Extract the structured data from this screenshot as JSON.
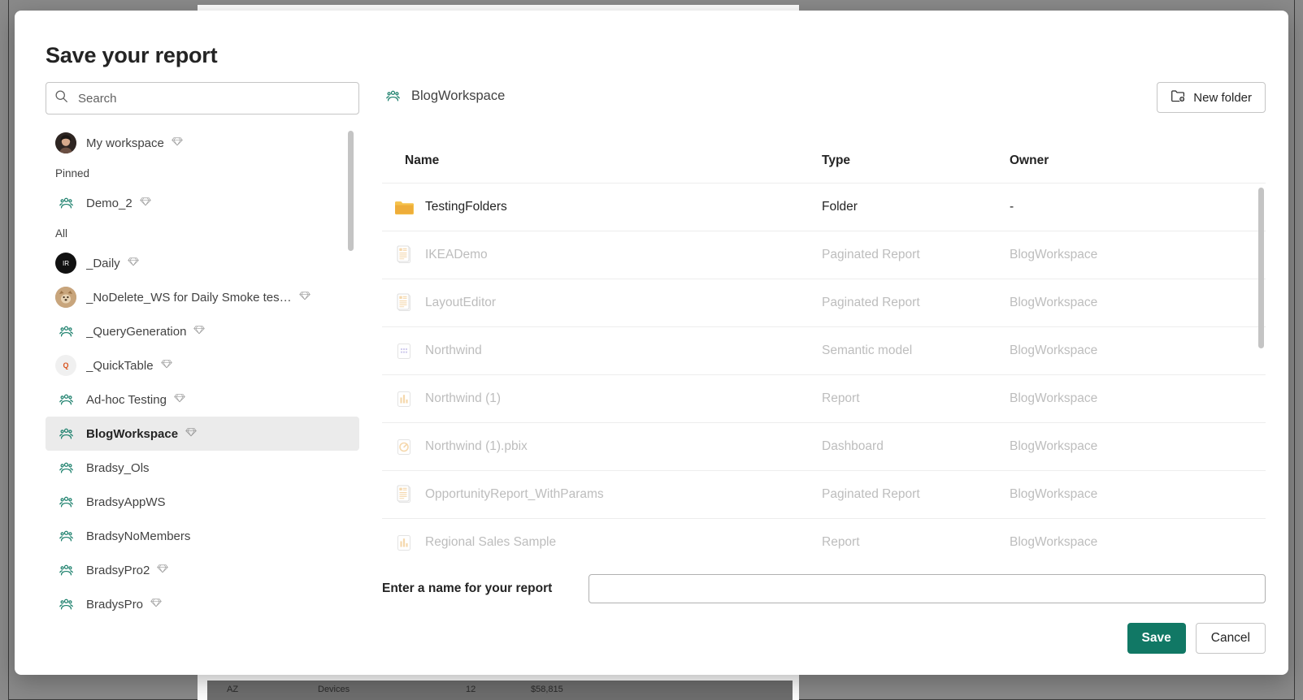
{
  "background": {
    "table_row": {
      "state": "AZ",
      "category": "Devices",
      "count": "12",
      "amount": "$58,815"
    }
  },
  "modal": {
    "title": "Save your report"
  },
  "search": {
    "placeholder": "Search",
    "value": "",
    "icon": "search-icon"
  },
  "sidebar": {
    "items": [
      {
        "label": "My workspace",
        "icon": "avatar-photo",
        "gem": true,
        "group": null,
        "selected": false
      },
      {
        "label": "Pinned",
        "group_header": true
      },
      {
        "label": "Demo_2",
        "icon": "workspace-icon",
        "gem": true,
        "selected": false
      },
      {
        "label": "All",
        "group_header": true
      },
      {
        "label": "_Daily",
        "icon": "avatar-dark",
        "gem": true,
        "selected": false
      },
      {
        "label": "_NoDelete_WS for Daily Smoke tes…",
        "icon": "avatar-dog",
        "gem": true,
        "selected": false
      },
      {
        "label": "_QueryGeneration",
        "icon": "workspace-icon",
        "gem": true,
        "selected": false
      },
      {
        "label": "_QuickTable",
        "icon": "avatar-quick",
        "gem": true,
        "selected": false
      },
      {
        "label": "Ad-hoc Testing",
        "icon": "workspace-icon",
        "gem": true,
        "selected": false
      },
      {
        "label": "BlogWorkspace",
        "icon": "workspace-icon",
        "gem": true,
        "selected": true
      },
      {
        "label": "Bradsy_Ols",
        "icon": "workspace-icon",
        "gem": false,
        "selected": false
      },
      {
        "label": "BradsyAppWS",
        "icon": "workspace-icon",
        "gem": false,
        "selected": false
      },
      {
        "label": "BradsyNoMembers",
        "icon": "workspace-icon",
        "gem": false,
        "selected": false
      },
      {
        "label": "BradsyPro2",
        "icon": "workspace-icon",
        "gem": true,
        "selected": false
      },
      {
        "label": "BradysPro",
        "icon": "workspace-icon",
        "gem": true,
        "selected": false
      }
    ]
  },
  "content": {
    "breadcrumb": "BlogWorkspace",
    "new_folder_label": "New folder",
    "new_folder_icon": "new-folder-icon",
    "columns": {
      "name": "Name",
      "type": "Type",
      "owner": "Owner"
    },
    "rows": [
      {
        "name": "TestingFolders",
        "type": "Folder",
        "owner": "-",
        "icon": "folder-icon",
        "enabled": true
      },
      {
        "name": "IKEADemo",
        "type": "Paginated Report",
        "owner": "BlogWorkspace",
        "icon": "paginated-report-icon",
        "enabled": false
      },
      {
        "name": "LayoutEditor",
        "type": "Paginated Report",
        "owner": "BlogWorkspace",
        "icon": "paginated-report-icon",
        "enabled": false
      },
      {
        "name": "Northwind",
        "type": "Semantic model",
        "owner": "BlogWorkspace",
        "icon": "semantic-model-icon",
        "enabled": false
      },
      {
        "name": "Northwind (1)",
        "type": "Report",
        "owner": "BlogWorkspace",
        "icon": "report-icon",
        "enabled": false
      },
      {
        "name": "Northwind (1).pbix",
        "type": "Dashboard",
        "owner": "BlogWorkspace",
        "icon": "dashboard-icon",
        "enabled": false
      },
      {
        "name": "OpportunityReport_WithParams",
        "type": "Paginated Report",
        "owner": "BlogWorkspace",
        "icon": "paginated-report-icon",
        "enabled": false
      },
      {
        "name": "Regional Sales Sample",
        "type": "Report",
        "owner": "BlogWorkspace",
        "icon": "report-icon",
        "enabled": false
      }
    ]
  },
  "name_field": {
    "label": "Enter a name for your report",
    "value": "",
    "placeholder": ""
  },
  "footer": {
    "save_label": "Save",
    "cancel_label": "Cancel"
  },
  "colors": {
    "accent_save": "#117865",
    "workspace_icon": "#1a7f6b",
    "folder": "#f2c14e",
    "selected_row_bg": "#ebebeb",
    "backdrop": "#8a8a8a"
  }
}
